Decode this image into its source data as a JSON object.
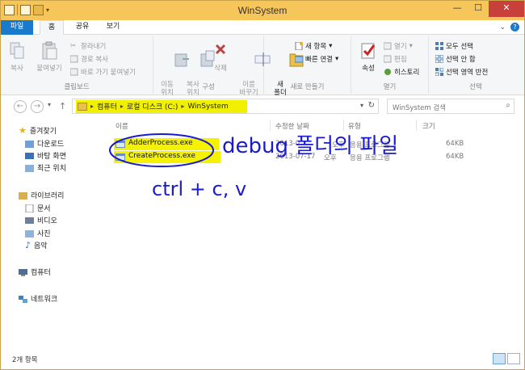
{
  "window": {
    "title": "WinSystem"
  },
  "ribbon_tabs": [
    "파일",
    "홈",
    "공유",
    "보기"
  ],
  "ribbon": {
    "clipboard": {
      "label": "클립보드",
      "copy": "복사",
      "paste": "붙여넣기",
      "cut": "잘라내기",
      "copy_path": "경로 복사",
      "paste_shortcut": "바로 가기 붙여넣기"
    },
    "organize": {
      "label": "구성",
      "move_to": "이동\n위치",
      "copy_to": "복사\n위치",
      "delete": "삭제",
      "rename": "이름\n바꾸기"
    },
    "new": {
      "label": "새로 만들기",
      "new_folder": "새\n폴더",
      "new_item": "새 항목",
      "easy_access": "빠른 연결"
    },
    "open": {
      "label": "열기",
      "properties": "속성",
      "open": "열기",
      "edit": "편집",
      "history": "히스토리"
    },
    "select": {
      "label": "선택",
      "select_all": "모두 선택",
      "select_none": "선택 안 함",
      "invert": "선택 영역 반전"
    }
  },
  "address": {
    "crumbs": [
      "컴퓨터",
      "로컬 디스크 (C:)",
      "WinSystem"
    ]
  },
  "search": {
    "placeholder": "WinSystem 검색"
  },
  "nav_pane": {
    "favorites": {
      "label": "즐겨찾기",
      "items": [
        "다운로드",
        "바탕 화면",
        "최근 위치"
      ]
    },
    "libraries": {
      "label": "라이브러리",
      "items": [
        "문서",
        "비디오",
        "사진",
        "음악"
      ]
    },
    "computer": "컴퓨터",
    "network": "네트워크"
  },
  "columns": {
    "name": "이름",
    "modified": "수정한 날짜",
    "type": "유형",
    "size": "크기"
  },
  "files": [
    {
      "name": "AdderProcess.exe",
      "modified": "2013-0",
      "modified_tail": "오후",
      "type": "응용 프로그램",
      "size": "64KB"
    },
    {
      "name": "CreateProcess.exe",
      "modified": "2013-07-17",
      "modified_tail": "오후",
      "type": "응용 프로그램",
      "size": "64KB"
    }
  ],
  "annotations": {
    "handwriting": "debug 폴더의 파일",
    "handwriting2": "ctrl + c, v"
  },
  "status": {
    "item_count": "2개 항목"
  }
}
